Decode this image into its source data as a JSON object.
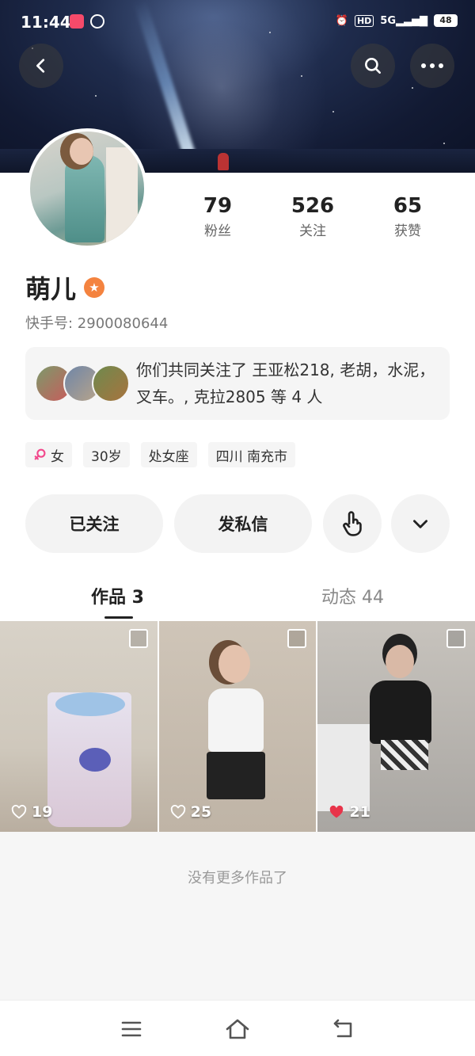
{
  "status_bar": {
    "time": "11:44",
    "network": "5G",
    "hd": "HD",
    "battery": "48"
  },
  "profile": {
    "name": "萌儿",
    "kuaishou_id": "快手号: 2900080644",
    "stats": [
      {
        "value": "79",
        "label": "粉丝"
      },
      {
        "value": "526",
        "label": "关注"
      },
      {
        "value": "65",
        "label": "获赞"
      }
    ]
  },
  "mutual_follow": {
    "text": "你们共同关注了 王亚松218, 老胡，水泥，叉车。, 克拉2805 等 4 人"
  },
  "tags": [
    {
      "icon": "female-icon",
      "label": "女"
    },
    {
      "label": "30岁"
    },
    {
      "label": "处女座"
    },
    {
      "label": "四川 南充市"
    }
  ],
  "actions": {
    "followed_label": "已关注",
    "message_label": "发私信"
  },
  "tabs": [
    {
      "label": "作品 3",
      "active": true
    },
    {
      "label": "动态 44",
      "active": false
    }
  ],
  "works": [
    {
      "likes": "19",
      "liked": false
    },
    {
      "likes": "25",
      "liked": false
    },
    {
      "likes": "21",
      "liked": true
    }
  ],
  "footer": {
    "no_more": "没有更多作品了"
  },
  "colors": {
    "accent": "#f4833f",
    "like_red": "#e8344a",
    "female_pink": "#f2498c"
  }
}
